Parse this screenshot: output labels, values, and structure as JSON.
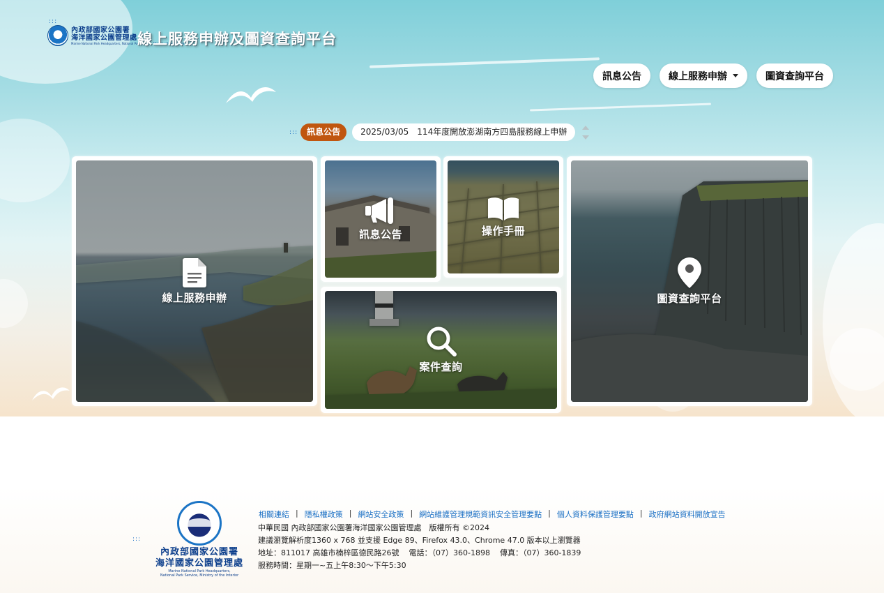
{
  "header": {
    "org_line1": "內政部國家公園署",
    "org_line2": "海洋國家公園管理處",
    "org_line3": "Marine National Park Headquarters, National Park Service, Ministry of the Interior",
    "site_title": "線上服務申辦及圖資查詢平台"
  },
  "nav": {
    "items": [
      {
        "label": "訊息公告"
      },
      {
        "label": "線上服務申辦"
      },
      {
        "label": "圖資查詢平台"
      }
    ]
  },
  "ticker": {
    "badge": "訊息公告",
    "date": "2025/03/05",
    "text": "114年度開放澎湖南方四島服務線上申辦"
  },
  "tiles": {
    "online_service": "線上服務申辦",
    "announcements": "訊息公告",
    "manual": "操作手冊",
    "case_query": "案件查詢",
    "map_platform": "圖資查詢平台"
  },
  "footer": {
    "org_line1": "內政部國家公園署",
    "org_line2": "海洋國家公園管理處",
    "org_line3a": "Marine National Park Headquarters,",
    "org_line3b": "National Park Service, Ministry of the Interior",
    "links": [
      "相關連結",
      "隱私權政策",
      "網站安全政策",
      "網站維護管理規範資訊安全管理要點",
      "個人資料保護管理要點",
      "政府網站資料開放宣告"
    ],
    "copyright": "中華民國 內政部國家公園署海洋國家公園管理處　版權所有 ©2024",
    "browser": "建議瀏覽解析度1360 x 768 並支援 Edge 89、Firefox 43.0、Chrome 47.0 版本以上瀏覽器",
    "address": "地址：811017 高雄市楠梓區德民路26號",
    "phone": "電話：（07）360-1898",
    "fax": "傳真：（07）360-1839",
    "hours": "服務時間：星期一~五上午8:30～下午5:30"
  },
  "colors": {
    "badge": "#c0560f",
    "link": "#1a6fc4",
    "brand": "#0d3f8c"
  }
}
